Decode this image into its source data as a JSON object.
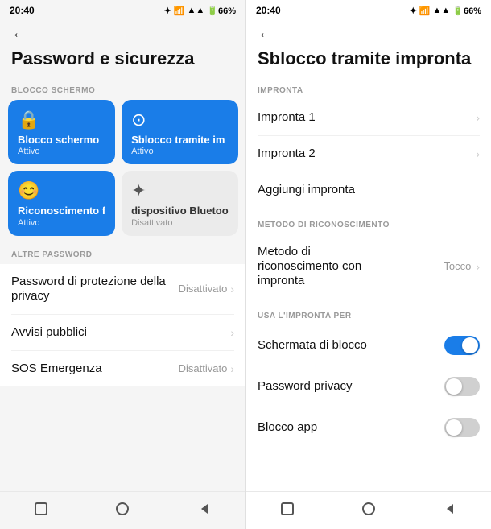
{
  "left": {
    "statusBar": {
      "time": "20:40",
      "icons": "🔵 ✦ 📶 📶 🔋 66%"
    },
    "back": "←",
    "title": "Password e sicurezza",
    "sectionBlockScreen": "BLOCCO SCHERMO",
    "tiles": [
      {
        "id": "blocco-schermo",
        "icon": "🔒",
        "title": "Blocco schermo",
        "subtitle": "Attivo",
        "type": "blue"
      },
      {
        "id": "sblocco-impronta",
        "icon": "⊙",
        "title": "Sblocco tramite im",
        "subtitle": "Attivo",
        "type": "blue"
      },
      {
        "id": "riconoscimento-f",
        "icon": "😊",
        "title": "Riconoscimento f",
        "subtitle": "Attivo",
        "type": "blue"
      },
      {
        "id": "bluetooth-device",
        "icon": "✦",
        "title": "dispositivo Bluetoo",
        "subtitle": "Disattivato",
        "type": "gray"
      }
    ],
    "sectionAltrePassword": "ALTRE PASSWORD",
    "rows": [
      {
        "id": "password-privacy",
        "label": "Password di protezione della privacy",
        "value": "Disattivato",
        "hasChevron": true
      },
      {
        "id": "avvisi-pubblici",
        "label": "Avvisi pubblici",
        "value": "",
        "hasChevron": true
      },
      {
        "id": "sos-emergenza",
        "label": "SOS Emergenza",
        "value": "Disattivato",
        "hasChevron": true
      }
    ],
    "nav": [
      "▬",
      "⬤",
      "◀"
    ]
  },
  "right": {
    "statusBar": {
      "time": "20:40",
      "icons": "🔵 ✦ 📶 📶 🔋 66%"
    },
    "back": "←",
    "title": "Sblocco tramite impronta",
    "sectionImpronta": "IMPRONTA",
    "improntaRows": [
      {
        "id": "impronta-1",
        "label": "Impronta 1",
        "hasChevron": true
      },
      {
        "id": "impronta-2",
        "label": "Impronta 2",
        "hasChevron": true
      },
      {
        "id": "aggiungi-impronta",
        "label": "Aggiungi impronta",
        "hasChevron": false
      }
    ],
    "sectionMetodo": "METODO DI RICONOSCIMENTO",
    "metodoRow": {
      "label": "Metodo di riconoscimento con impronta",
      "value": "Tocco"
    },
    "sectionUsaImpronta": "USA L'IMPRONTA PER",
    "toggleRows": [
      {
        "id": "schermata-blocco",
        "label": "Schermata di blocco",
        "on": true
      },
      {
        "id": "password-privacy",
        "label": "Password privacy",
        "on": false
      },
      {
        "id": "blocco-app",
        "label": "Blocco app",
        "on": false
      }
    ],
    "nav": [
      "▬",
      "⬤",
      "◀"
    ]
  }
}
